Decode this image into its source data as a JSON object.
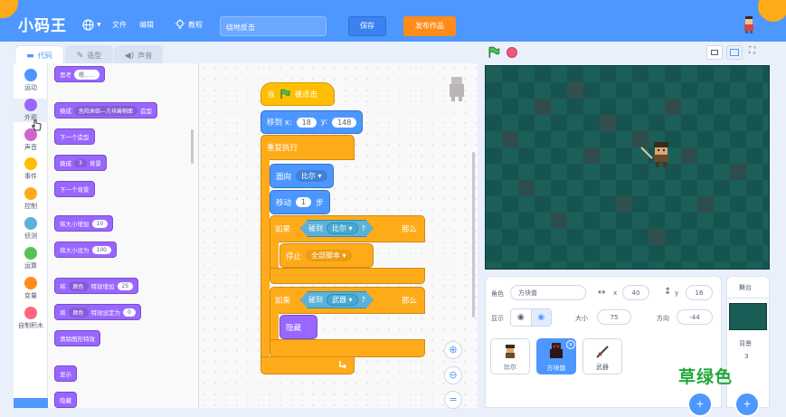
{
  "app": {
    "logo": "小码王"
  },
  "menubar": {
    "language_icon": "globe-icon",
    "file": "文件",
    "edit": "编辑",
    "tutorial_icon": "bulb-icon",
    "tutorial": "教程",
    "project_name": "绕地反击",
    "save": "保存",
    "publish": "发布作品"
  },
  "tabs": {
    "code": "代码",
    "costume": "造型",
    "sound": "声音"
  },
  "categories": [
    {
      "label": "运动",
      "color": "#4c97ff"
    },
    {
      "label": "外观",
      "color": "#9966ff"
    },
    {
      "label": "声音",
      "color": "#cf63cf"
    },
    {
      "label": "事件",
      "color": "#ffbf00"
    },
    {
      "label": "控制",
      "color": "#ffab19"
    },
    {
      "label": "侦测",
      "color": "#5cb1d6"
    },
    {
      "label": "运算",
      "color": "#59c059"
    },
    {
      "label": "变量",
      "color": "#ff8c1a"
    },
    {
      "label": "自制积木",
      "color": "#ff6680"
    }
  ],
  "palette": {
    "think_label": "思考",
    "think_value": "嗯……",
    "switch_costume_label": "换成",
    "switch_costume_value": "危险来临—方块兽侧面",
    "switch_costume_suffix": "造型",
    "next_costume": "下一个造型",
    "switch_backdrop_label": "换成",
    "switch_backdrop_value": "3",
    "switch_backdrop_suffix": "背景",
    "next_backdrop": "下一个背景",
    "change_size_label": "将大小增加",
    "change_size_value": "10",
    "set_size_label": "将大小设为",
    "set_size_value": "100",
    "change_effect_label": "将",
    "change_effect_dd": "颜色",
    "change_effect_mid": "特效增加",
    "change_effect_value": "25",
    "set_effect_label": "将",
    "set_effect_dd": "颜色",
    "set_effect_mid": "特效设定为",
    "set_effect_value": "0",
    "clear_effects": "清除图形特效",
    "show": "显示",
    "hide": "隐藏"
  },
  "script": {
    "hat_when": "当",
    "hat_flag_icon": "green-flag-icon",
    "hat_clicked": "被点击",
    "goto_label": "移到 x:",
    "goto_x": "18",
    "goto_y_label": "y:",
    "goto_y": "148",
    "forever": "重复执行",
    "point_label": "面向",
    "point_target": "比尔",
    "move_label": "移动",
    "move_steps": "1",
    "move_unit": "步",
    "if1_label": "如果",
    "if1_touch": "碰到",
    "if1_target": "比尔",
    "if1_q": "?",
    "if1_then": "那么",
    "stop_label": "停止",
    "stop_option": "全部脚本",
    "if2_label": "如果",
    "if2_touch": "碰到",
    "if2_target": "武器",
    "if2_q": "?",
    "if2_then": "那么",
    "hide": "隐藏"
  },
  "sprite_info": {
    "sprite_label": "角色",
    "sprite_name": "方块兽",
    "x_label": "x",
    "x": "40",
    "y_label": "y",
    "y": "16",
    "show_label": "显示",
    "size_label": "大小",
    "size": "75",
    "direction_label": "方向",
    "direction": "-44"
  },
  "sprites": [
    {
      "name": "比尔",
      "selected": false
    },
    {
      "name": "方块兽",
      "selected": true
    },
    {
      "name": "武器",
      "selected": false
    }
  ],
  "stage_panel": {
    "title": "舞台",
    "backdrops_label": "背景",
    "backdrops_count": "3"
  },
  "watermark": "草绿色",
  "colors": {
    "accent": "#4d97ff",
    "stage_bg": "#1a5c56",
    "publish": "#ff8c1a"
  }
}
